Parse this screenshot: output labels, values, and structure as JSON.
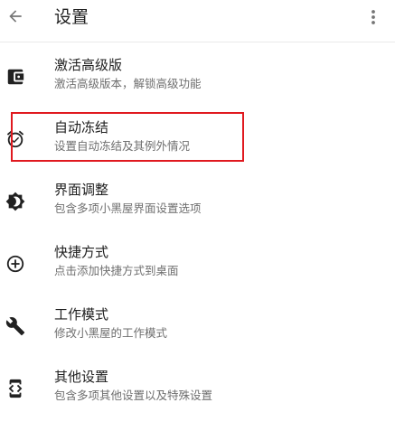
{
  "appbar": {
    "title": "设置",
    "back_icon": "arrow-back-icon",
    "more_icon": "more-vert-icon"
  },
  "items": [
    {
      "title": "激活高级版",
      "subtitle": "激活高级版本，解锁高级功能",
      "icon": "wallet-icon"
    },
    {
      "title": "自动冻结",
      "subtitle": "设置自动冻结及其例外情况",
      "icon": "alarm-check-icon"
    },
    {
      "title": "界面调整",
      "subtitle": "包含多项小黑屋界面设置选项",
      "icon": "brightness-icon"
    },
    {
      "title": "快捷方式",
      "subtitle": "点击添加快捷方式到桌面",
      "icon": "add-circle-icon"
    },
    {
      "title": "工作模式",
      "subtitle": "修改小黑屋的工作模式",
      "icon": "wrench-icon"
    },
    {
      "title": "其他设置",
      "subtitle": "包含多项其他设置以及特殊设置",
      "icon": "developer-mode-icon"
    }
  ],
  "highlight_color": "#e0191f"
}
